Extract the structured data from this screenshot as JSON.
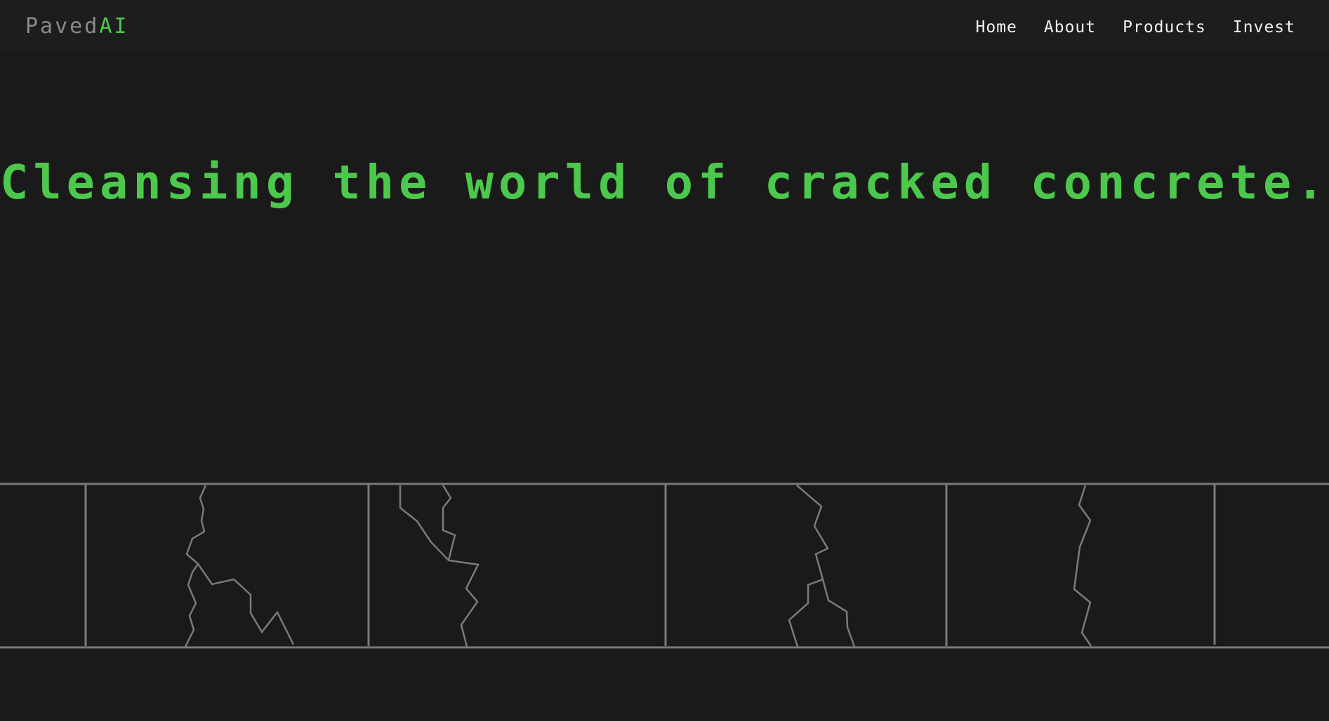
{
  "brand": {
    "name_main": "Paved",
    "name_accent": "AI",
    "colors": {
      "background": "#1b1a1a",
      "navbar": "#1d1d1d",
      "accent": "#4cc94c",
      "logo_main": "#8a8a8a",
      "nav_text": "#f2f2f2",
      "sidewalk_line": "#7a7a7a"
    }
  },
  "nav": {
    "items": [
      {
        "label": "Home"
      },
      {
        "label": "About"
      },
      {
        "label": "Products"
      },
      {
        "label": "Invest"
      }
    ]
  },
  "hero": {
    "title": "Cleansing the world of cracked concrete."
  },
  "illustration": {
    "name": "cracked-sidewalk",
    "slab_count": 6,
    "cracked_slab_count": 4
  }
}
